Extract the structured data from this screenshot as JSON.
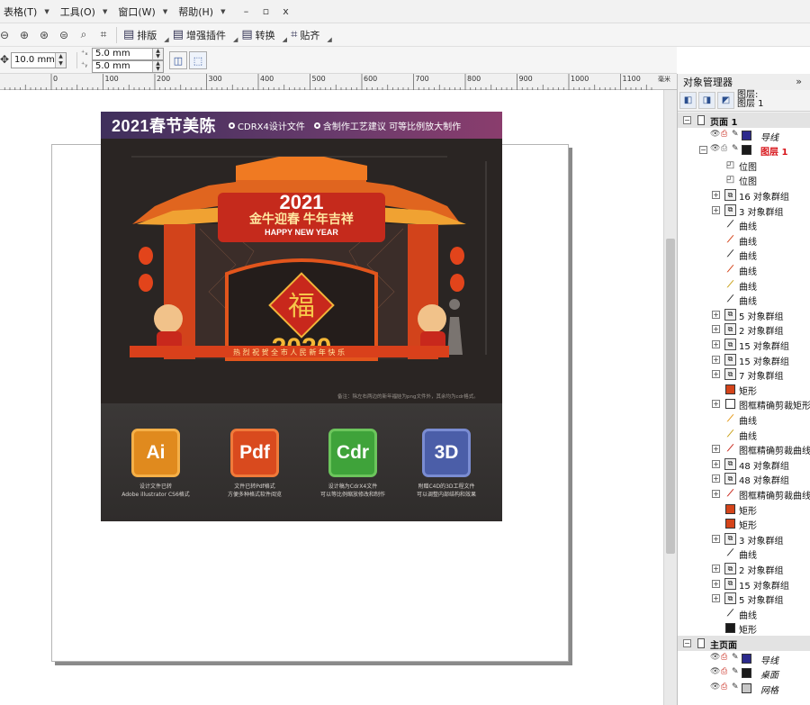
{
  "menu": {
    "items": [
      {
        "label": "表格(T)"
      },
      {
        "label": "工具(O)"
      },
      {
        "label": "窗口(W)"
      },
      {
        "label": "帮助(H)"
      }
    ],
    "window_controls": [
      "–",
      "▫",
      "x"
    ]
  },
  "toolbar": {
    "buttons": [
      {
        "label": "排版",
        "icon": "layout-icon"
      },
      {
        "label": "增强插件",
        "icon": "plugin-icon"
      },
      {
        "label": "转换",
        "icon": "convert-icon"
      },
      {
        "label": "贴齐",
        "icon": "snap-icon"
      }
    ]
  },
  "propbar": {
    "nudge_value": "10.0 mm",
    "dup_x": "5.0 mm",
    "dup_y": "5.0 mm"
  },
  "ruler": {
    "labels": [
      "0",
      "100",
      "200",
      "300",
      "400",
      "500",
      "600",
      "700",
      "800",
      "900",
      "1000",
      "1100"
    ],
    "unit": "毫米"
  },
  "design": {
    "title": "2021春节美陈",
    "note1": "CDRX4设计文件",
    "note2": "含制作工艺建议 可等比例放大制作",
    "arch_year": "2021",
    "arch_slogan": "金牛迎春 牛年吉祥",
    "arch_english": "HAPPY NEW YEAR",
    "fu_char": "福",
    "banner_text": "热 烈 祝 贺 全 市 人 民 新 年 快 乐",
    "bottom_year": "2020",
    "footnote": "备注：除左右两边的新年福娃为png文件外，其余均为cdr格式。",
    "badges": [
      {
        "label": "Ai",
        "color": "#e08a1e",
        "caption1": "设计文件已转",
        "caption2": "Adobe illustrator CS6格式"
      },
      {
        "label": "Pdf",
        "color": "#d94a1e",
        "caption1": "文件已转Pdf格式",
        "caption2": "方便多种格式软件阅览"
      },
      {
        "label": "Cdr",
        "color": "#3fa33a",
        "caption1": "设计稿为CdrX4文件",
        "caption2": "可以等比例缩放修改和制作"
      },
      {
        "label": "3D",
        "color": "#4b5ea8",
        "caption1": "附赠C4D的3D工程文件",
        "caption2": "可以调整内部结构和效果"
      }
    ]
  },
  "docker": {
    "title": "对象管理器",
    "layer_label": "图层:",
    "layer_value": "图层 1",
    "tree": [
      {
        "label": "页面 1",
        "kind": "page"
      },
      {
        "label": "导线",
        "kind": "layer",
        "color": "#2c2a8c"
      },
      {
        "label": "图层 1",
        "kind": "layer-active",
        "color": "#1a1a1a"
      },
      {
        "label": "位图",
        "kind": "bitmap"
      },
      {
        "label": "位图",
        "kind": "bitmap"
      },
      {
        "label": "16 对象群组",
        "kind": "group"
      },
      {
        "label": "3 对象群组",
        "kind": "group"
      },
      {
        "label": "曲线",
        "kind": "curve",
        "color": "#333333"
      },
      {
        "label": "曲线",
        "kind": "curve",
        "color": "#d4441a"
      },
      {
        "label": "曲线",
        "kind": "curve",
        "color": "#333333"
      },
      {
        "label": "曲线",
        "kind": "curve",
        "color": "#d4441a"
      },
      {
        "label": "曲线",
        "kind": "curve",
        "color": "#c9a21c"
      },
      {
        "label": "曲线",
        "kind": "curve",
        "color": "#333333"
      },
      {
        "label": "5 对象群组",
        "kind": "group"
      },
      {
        "label": "2 对象群组",
        "kind": "group"
      },
      {
        "label": "15 对象群组",
        "kind": "group"
      },
      {
        "label": "15 对象群组",
        "kind": "group"
      },
      {
        "label": "7 对象群组",
        "kind": "group"
      },
      {
        "label": "矩形",
        "kind": "rect",
        "color": "#d4441a"
      },
      {
        "label": "图框精确剪裁矩形",
        "kind": "powerclip-rect"
      },
      {
        "label": "曲线",
        "kind": "curve",
        "color": "#e69a1a"
      },
      {
        "label": "曲线",
        "kind": "curve",
        "color": "#c9a21c"
      },
      {
        "label": "图框精确剪裁曲线",
        "kind": "powerclip-curve",
        "color": "#c8281c"
      },
      {
        "label": "48 对象群组",
        "kind": "group"
      },
      {
        "label": "48 对象群组",
        "kind": "group"
      },
      {
        "label": "图框精确剪裁曲线",
        "kind": "powerclip-curve",
        "color": "#c8281c"
      },
      {
        "label": "矩形",
        "kind": "rect",
        "color": "#d4441a"
      },
      {
        "label": "矩形",
        "kind": "rect",
        "color": "#d4441a"
      },
      {
        "label": "3 对象群组",
        "kind": "group"
      },
      {
        "label": "曲线",
        "kind": "curve",
        "color": "#333333"
      },
      {
        "label": "2 对象群组",
        "kind": "group"
      },
      {
        "label": "15 对象群组",
        "kind": "group"
      },
      {
        "label": "5 对象群组",
        "kind": "group"
      },
      {
        "label": "曲线",
        "kind": "curve",
        "color": "#333333"
      },
      {
        "label": "矩形",
        "kind": "rect",
        "color": "#1a1a1a"
      },
      {
        "label": "主页面",
        "kind": "page"
      },
      {
        "label": "导线",
        "kind": "layer",
        "color": "#2c2a8c"
      },
      {
        "label": "桌面",
        "kind": "layer",
        "color": "#1a1a1a"
      },
      {
        "label": "网格",
        "kind": "layer",
        "color": "#c8c8c8"
      }
    ]
  }
}
